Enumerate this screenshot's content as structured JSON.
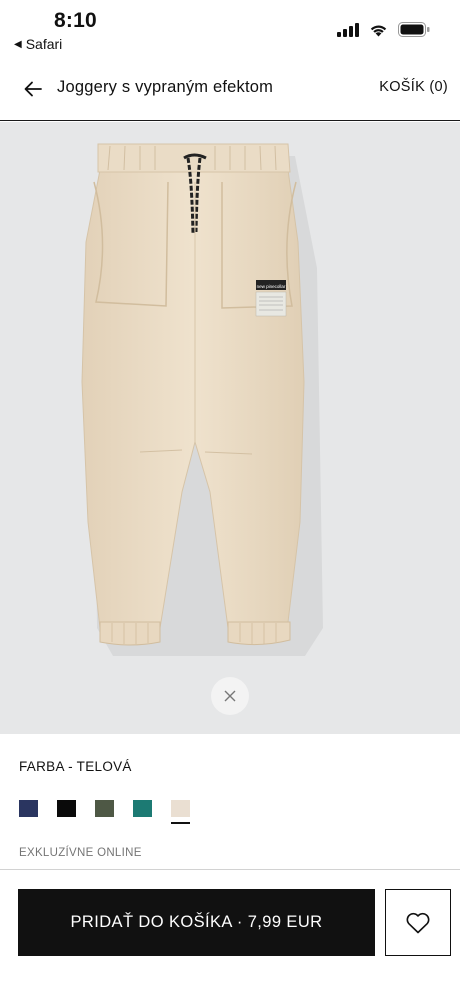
{
  "status_bar": {
    "time": "8:10",
    "back_app": "Safari",
    "icons": [
      "cellular-signal-icon",
      "wifi-icon",
      "battery-icon"
    ]
  },
  "header": {
    "title": "Joggery s vypraným efektom",
    "cart_label": "KOŠÍK (0)"
  },
  "product": {
    "label_text": "new pinecollar"
  },
  "color": {
    "label": "FARBA - TELOVÁ",
    "swatches": [
      {
        "name": "navy",
        "color": "#2a3560",
        "selected": false
      },
      {
        "name": "black",
        "color": "#0a0a0a",
        "selected": false
      },
      {
        "name": "olive",
        "color": "#4e5845",
        "selected": false
      },
      {
        "name": "teal",
        "color": "#1c7a73",
        "selected": false
      },
      {
        "name": "beige",
        "color": "#eadfd2",
        "selected": true
      }
    ]
  },
  "exclusive_label": "EXKLUZÍVNE ONLINE",
  "actions": {
    "add_to_cart_label": "PRIDAŤ DO KOŠÍKA · 7,99 EUR"
  },
  "colors": {
    "primary": "#111111",
    "product_bg": "#e6e7e8",
    "pants": "#ebdcc5"
  }
}
